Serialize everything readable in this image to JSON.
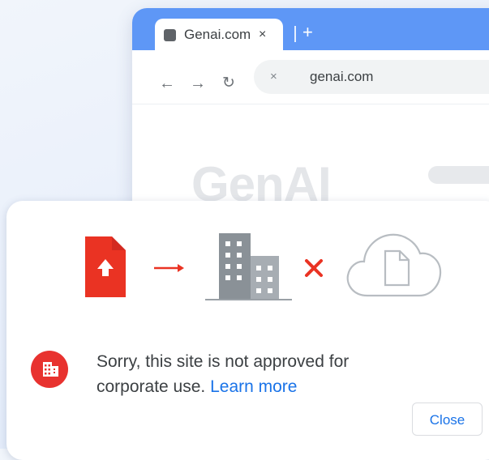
{
  "browser": {
    "tab_title": "Genai.com",
    "tab_close": "×",
    "new_tab": "+",
    "nav": {
      "back": "←",
      "forward": "→",
      "reload": "↻"
    },
    "omnibox_clear": "×",
    "url": "genai.com",
    "page_logo": "GenAI",
    "tab_bar_color": "#5e97f6"
  },
  "illustration": {
    "icons": [
      "file-upload-icon",
      "arrow-right-icon",
      "office-building-icon",
      "blocked-x-icon",
      "cloud-document-icon"
    ],
    "upload_color": "#ea3323",
    "block_color": "#ea3323",
    "building_color": "#8a9197"
  },
  "dialog": {
    "message": "Sorry, this site is not approved for corporate use.",
    "learn_more": "Learn more",
    "close_label": "Close",
    "badge_icon": "building-icon",
    "accent_color": "#1a73e8",
    "warning_color": "#e8322f"
  }
}
